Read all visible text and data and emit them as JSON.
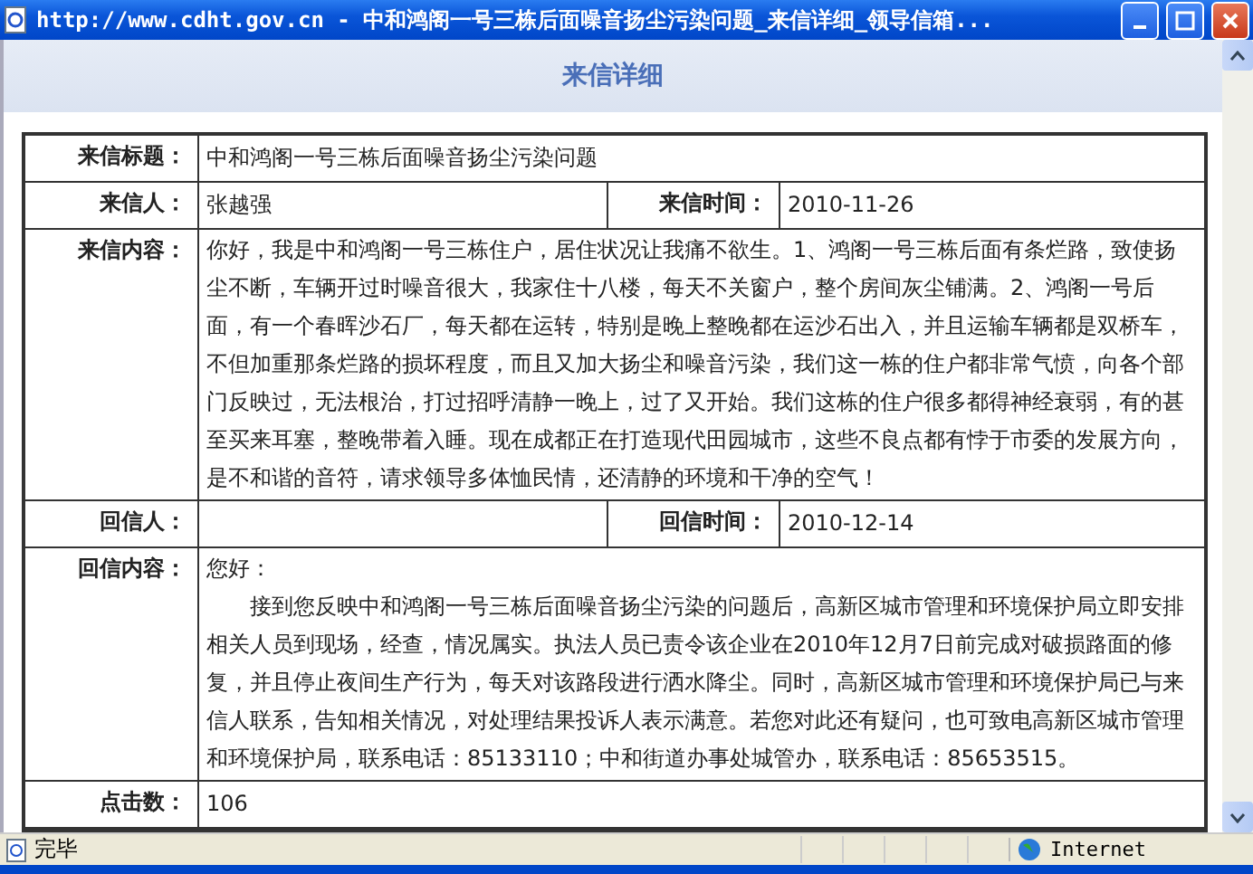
{
  "window": {
    "title": "http://www.cdht.gov.cn - 中和鸿阁一号三栋后面噪音扬尘污染问题_来信详细_领导信箱..."
  },
  "page": {
    "heading": "来信详细"
  },
  "letter": {
    "title_label": "来信标题：",
    "title": "中和鸿阁一号三栋后面噪音扬尘污染问题",
    "sender_label": "来信人：",
    "sender": "张越强",
    "time_label": "来信时间：",
    "time": "2010-11-26",
    "content_label": "来信内容：",
    "content": "你好，我是中和鸿阁一号三栋住户，居住状况让我痛不欲生。1、鸿阁一号三栋后面有条烂路，致使扬尘不断，车辆开过时噪音很大，我家住十八楼，每天不关窗户，整个房间灰尘铺满。2、鸿阁一号后面，有一个春晖沙石厂，每天都在运转，特别是晚上整晚都在运沙石出入，并且运输车辆都是双桥车，不但加重那条烂路的损坏程度，而且又加大扬尘和噪音污染，我们这一栋的住户都非常气愤，向各个部门反映过，无法根治，打过招呼清静一晚上，过了又开始。我们这栋的住户很多都得神经衰弱，有的甚至买来耳塞，整晚带着入睡。现在成都正在打造现代田园城市，这些不良点都有悖于市委的发展方向，是不和谐的音符，请求领导多体恤民情，还清静的环境和干净的空气！"
  },
  "reply": {
    "replier_label": "回信人：",
    "time_label": "回信时间：",
    "time": "2010-12-14",
    "content_label": "回信内容：",
    "paragraphs": [
      {
        "text": "您好：",
        "indented": false
      },
      {
        "text": "接到您反映中和鸿阁一号三栋后面噪音扬尘污染的问题后，高新区城市管理和环境保护局立即安排相关人员到现场，经查，情况属实。执法人员已责令该企业在2010年12月7日前完成对破损路面的修复，并且停止夜间生产行为，每天对该路段进行洒水降尘。同时，高新区城市管理和环境保护局已与来信人联系，告知相关情况，对处理结果投诉人表示满意。若您对此还有疑问，也可致电高新区城市管理和环境保护局，联系电话：85133110；中和街道办事处城管办，联系电话：85653515。",
        "indented": true
      }
    ]
  },
  "clicks": {
    "label": "点击数：",
    "value": "106"
  },
  "status_bar": {
    "text": "完毕",
    "zone": "Internet"
  }
}
